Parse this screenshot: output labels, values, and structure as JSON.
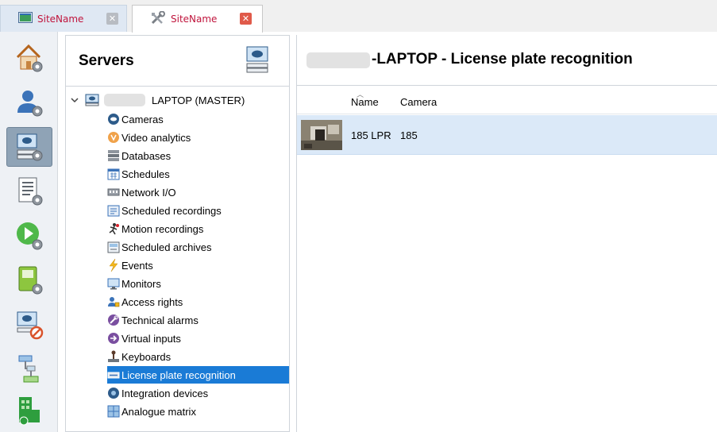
{
  "tabs": [
    {
      "label": "SiteName",
      "close": "✕"
    },
    {
      "label": "SiteName",
      "close": "✕"
    }
  ],
  "sidebar": {
    "items": [
      {
        "name": "home-settings-icon"
      },
      {
        "name": "user-settings-icon"
      },
      {
        "name": "server-settings-icon",
        "active": true
      },
      {
        "name": "list-settings-icon"
      },
      {
        "name": "play-settings-icon"
      },
      {
        "name": "device-settings-icon"
      },
      {
        "name": "server-alert-icon"
      },
      {
        "name": "network-map-icon"
      },
      {
        "name": "building-icon"
      }
    ]
  },
  "servers": {
    "title": "Servers",
    "root_label": "LAPTOP (MASTER)",
    "items": [
      {
        "label": "Cameras"
      },
      {
        "label": "Video analytics"
      },
      {
        "label": "Databases"
      },
      {
        "label": "Schedules"
      },
      {
        "label": "Network I/O"
      },
      {
        "label": "Scheduled recordings"
      },
      {
        "label": "Motion recordings"
      },
      {
        "label": "Scheduled archives"
      },
      {
        "label": "Events"
      },
      {
        "label": "Monitors"
      },
      {
        "label": "Access rights"
      },
      {
        "label": "Technical alarms"
      },
      {
        "label": "Virtual inputs"
      },
      {
        "label": "Keyboards"
      },
      {
        "label": "License plate recognition",
        "selected": true
      },
      {
        "label": "Integration devices"
      },
      {
        "label": "Analogue matrix"
      }
    ]
  },
  "main": {
    "title": "-LAPTOP - License plate recognition",
    "columns": {
      "name": "Name",
      "camera": "Camera"
    },
    "rows": [
      {
        "name": "185 LPR",
        "camera": "185"
      }
    ]
  },
  "colors": {
    "tab_text": "#c0143c",
    "selection": "#1a7bd6",
    "row_highlight": "#dbe9f8",
    "sidebar_active": "#8fa3b6"
  }
}
